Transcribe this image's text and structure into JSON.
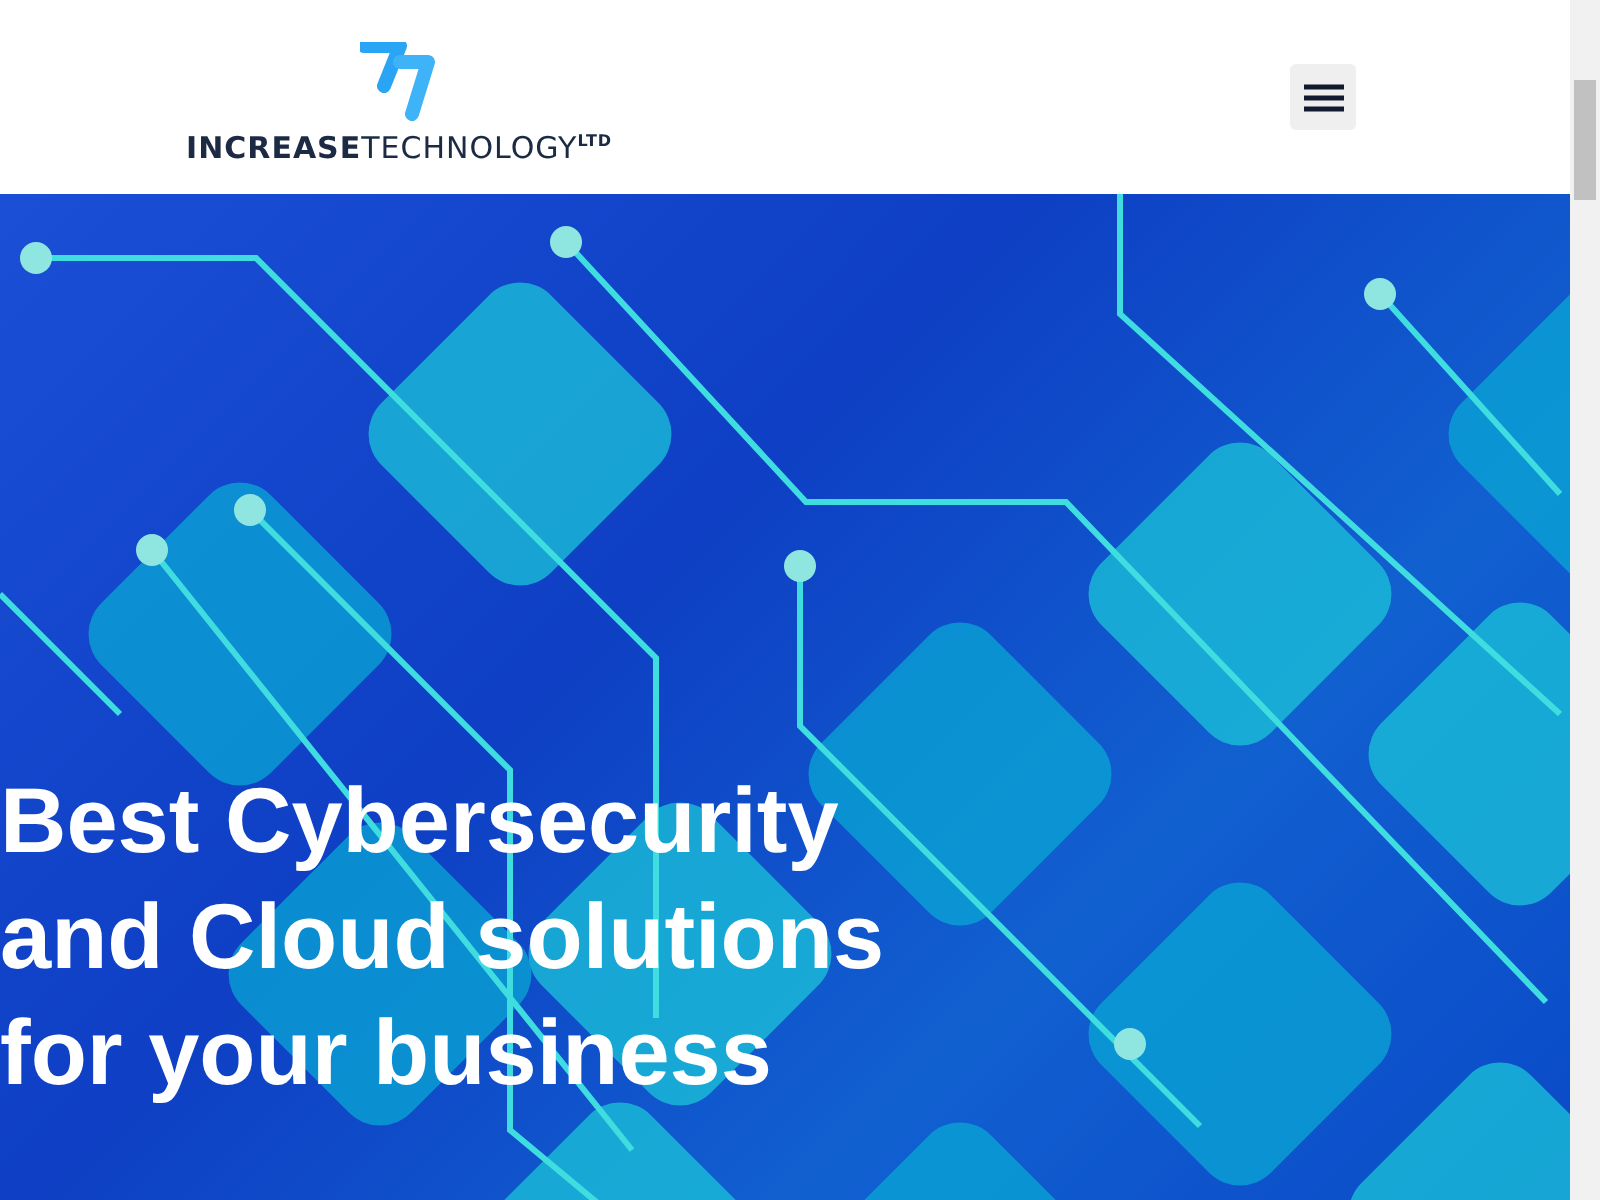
{
  "header": {
    "logo_text": "**INCREASE**TECHNOLOGY$^{LTD}$"
  },
  "hero": {
    "heading": "Best Cybersecurity and Cloud solutions for your business"
  }
}
